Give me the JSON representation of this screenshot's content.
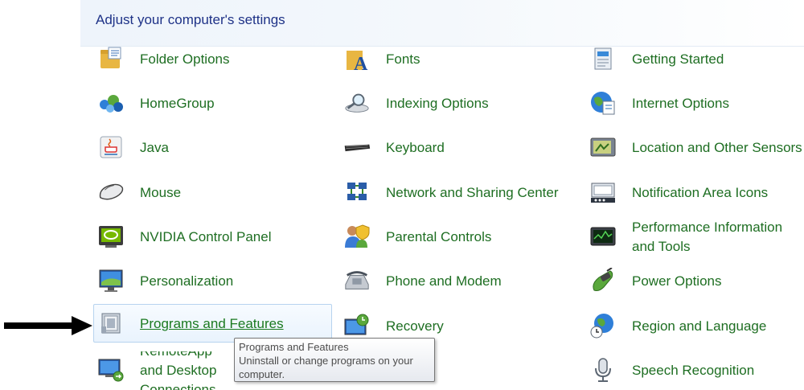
{
  "header": {
    "title": "Adjust your computer's settings"
  },
  "columns": [
    [
      {
        "label": "Folder Options",
        "icon": "folder-options-icon"
      },
      {
        "label": "HomeGroup",
        "icon": "homegroup-icon"
      },
      {
        "label": "Java",
        "icon": "java-icon"
      },
      {
        "label": "Mouse",
        "icon": "mouse-icon"
      },
      {
        "label": "NVIDIA Control Panel",
        "icon": "nvidia-icon"
      },
      {
        "label": "Personalization",
        "icon": "personalization-icon"
      },
      {
        "label": "Programs and Features",
        "icon": "programs-features-icon"
      },
      {
        "label": "RemoteApp and Desktop Connections",
        "icon": "remoteapp-icon"
      }
    ],
    [
      {
        "label": "Fonts",
        "icon": "fonts-icon"
      },
      {
        "label": "Indexing Options",
        "icon": "indexing-icon"
      },
      {
        "label": "Keyboard",
        "icon": "keyboard-icon"
      },
      {
        "label": "Network and Sharing Center",
        "icon": "network-icon"
      },
      {
        "label": "Parental Controls",
        "icon": "parental-controls-icon"
      },
      {
        "label": "Phone and Modem",
        "icon": "phone-modem-icon"
      },
      {
        "label": "Recovery",
        "icon": "recovery-icon"
      }
    ],
    [
      {
        "label": "Getting Started",
        "icon": "getting-started-icon"
      },
      {
        "label": "Internet Options",
        "icon": "internet-options-icon"
      },
      {
        "label": "Location and Other Sensors",
        "icon": "location-sensors-icon"
      },
      {
        "label": "Notification Area Icons",
        "icon": "notification-area-icon"
      },
      {
        "label": "Performance Information and Tools",
        "icon": "performance-icon"
      },
      {
        "label": "Power Options",
        "icon": "power-options-icon"
      },
      {
        "label": "Region and Language",
        "icon": "region-language-icon"
      },
      {
        "label": "Speech Recognition",
        "icon": "microphone-icon"
      }
    ]
  ],
  "tooltip": {
    "title": "Programs and Features",
    "description": "Uninstall or change programs on your computer."
  },
  "colors": {
    "link": "#1e6e22",
    "header_text": "#1e3287",
    "hover_border": "#b7d3ef"
  }
}
